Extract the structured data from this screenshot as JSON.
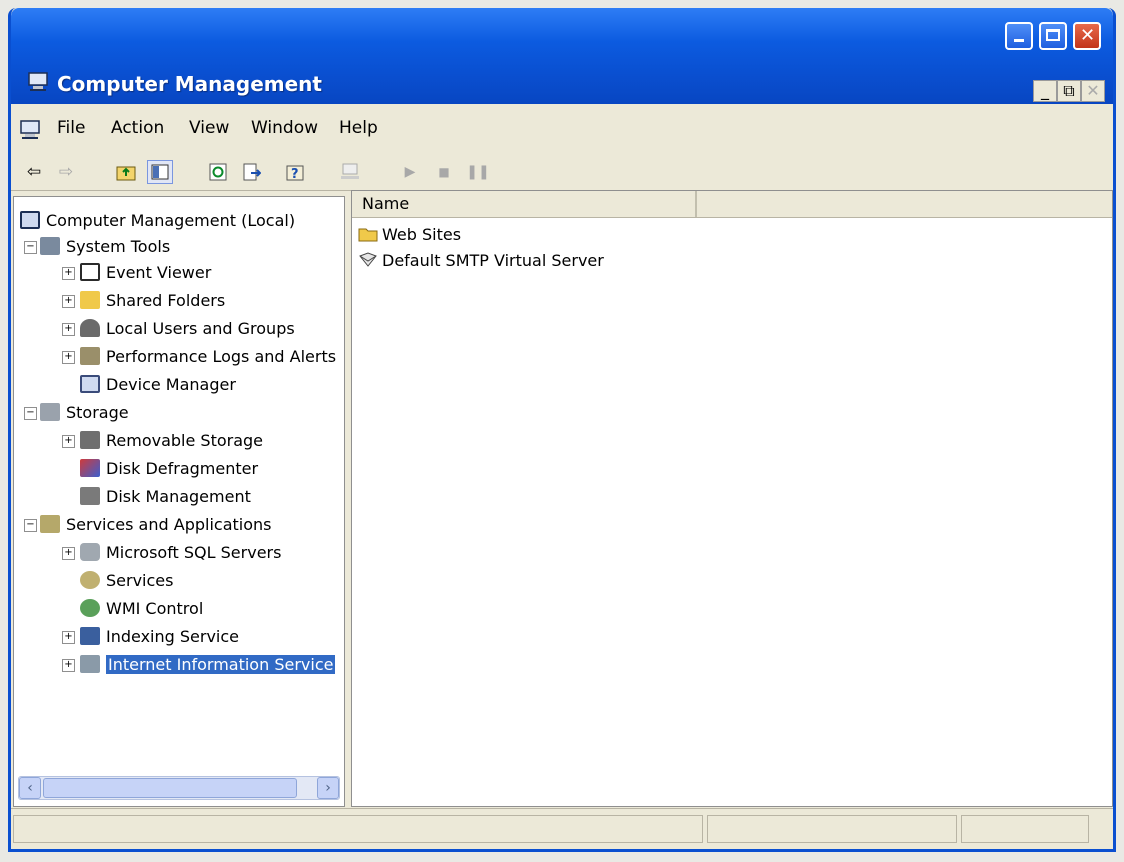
{
  "window": {
    "title": "Computer Management",
    "controls": {
      "minimize": "minimize-button",
      "maximize": "maximize-button",
      "close": "close-button"
    }
  },
  "menu": {
    "items": [
      "File",
      "Action",
      "View",
      "Window",
      "Help"
    ]
  },
  "toolbar": {
    "buttons": [
      "back-icon",
      "forward-icon",
      "up-folder-icon",
      "show-hide-tree-icon",
      "refresh-icon",
      "export-list-icon",
      "help-icon",
      "connect-icon",
      "start-icon",
      "stop-icon",
      "pause-icon"
    ]
  },
  "tree": {
    "root": "Computer Management (Local)",
    "nodes": [
      {
        "label": "System Tools"
      },
      {
        "label": "Event Viewer"
      },
      {
        "label": "Shared Folders"
      },
      {
        "label": "Local Users and Groups"
      },
      {
        "label": "Performance Logs and Alerts"
      },
      {
        "label": "Device Manager"
      },
      {
        "label": "Storage"
      },
      {
        "label": "Removable Storage"
      },
      {
        "label": "Disk Defragmenter"
      },
      {
        "label": "Disk Management"
      },
      {
        "label": "Services and Applications"
      },
      {
        "label": "Microsoft SQL Servers"
      },
      {
        "label": "Services"
      },
      {
        "label": "WMI Control"
      },
      {
        "label": "Indexing Service"
      },
      {
        "label": "Internet Information Service"
      }
    ],
    "selected": "Internet Information Service"
  },
  "list": {
    "column_header": "Name",
    "items": [
      "Web Sites",
      "Default SMTP Virtual Server"
    ]
  },
  "colors": {
    "titlebar": "#0a4fd0",
    "selection": "#316ac5",
    "window_bg": "#ece9d8"
  }
}
